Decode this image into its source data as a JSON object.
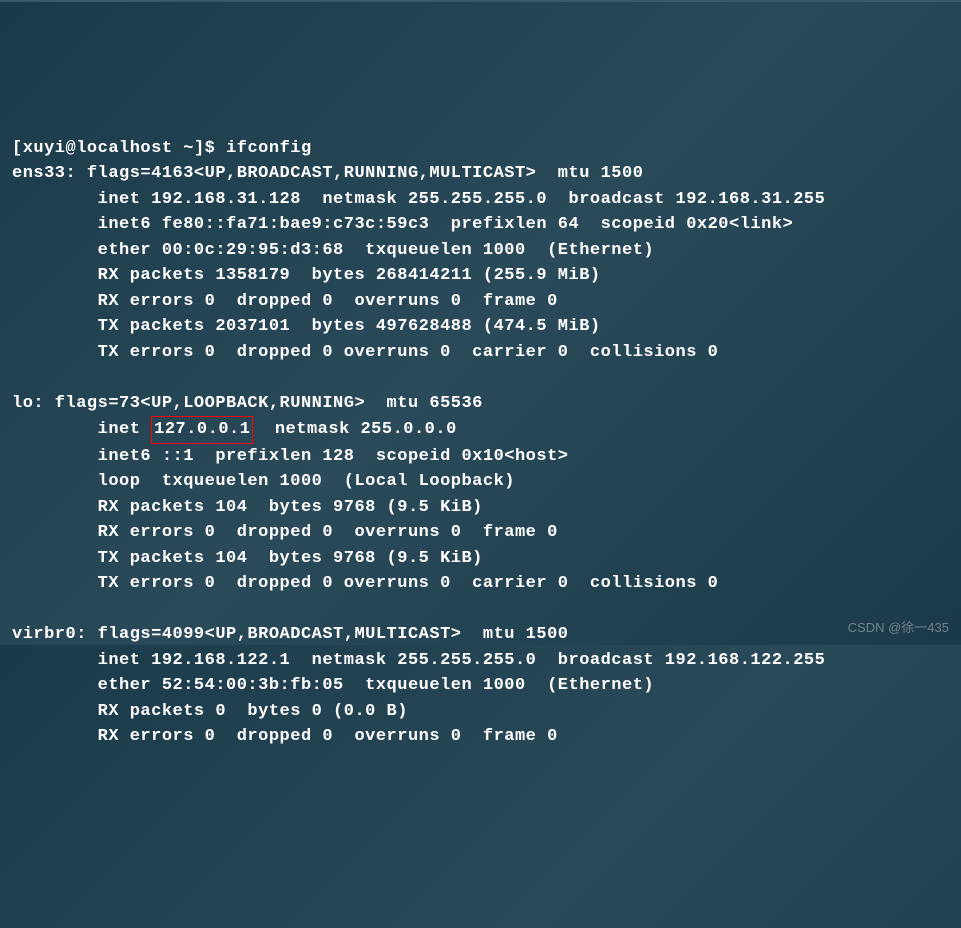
{
  "prompt": {
    "user": "xuyi",
    "host": "localhost",
    "dir": "~",
    "symbol": "$",
    "command": "ifconfig"
  },
  "interfaces": {
    "ens33": {
      "header": "ens33: flags=4163<UP,BROADCAST,RUNNING,MULTICAST>  mtu 1500",
      "inet": "        inet 192.168.31.128  netmask 255.255.255.0  broadcast 192.168.31.255",
      "inet6": "        inet6 fe80::fa71:bae9:c73c:59c3  prefixlen 64  scopeid 0x20<link>",
      "ether": "        ether 00:0c:29:95:d3:68  txqueuelen 1000  (Ethernet)",
      "rx_packets": "        RX packets 1358179  bytes 268414211 (255.9 MiB)",
      "rx_errors": "        RX errors 0  dropped 0  overruns 0  frame 0",
      "tx_packets": "        TX packets 2037101  bytes 497628488 (474.5 MiB)",
      "tx_errors": "        TX errors 0  dropped 0 overruns 0  carrier 0  collisions 0"
    },
    "lo": {
      "header": "lo: flags=73<UP,LOOPBACK,RUNNING>  mtu 65536",
      "inet_prefix": "        inet ",
      "inet_ip": "127.0.0.1",
      "inet_suffix": "  netmask 255.0.0.0",
      "inet6": "        inet6 ::1  prefixlen 128  scopeid 0x10<host>",
      "loop": "        loop  txqueuelen 1000  (Local Loopback)",
      "rx_packets": "        RX packets 104  bytes 9768 (9.5 KiB)",
      "rx_errors": "        RX errors 0  dropped 0  overruns 0  frame 0",
      "tx_packets": "        TX packets 104  bytes 9768 (9.5 KiB)",
      "tx_errors": "        TX errors 0  dropped 0 overruns 0  carrier 0  collisions 0"
    },
    "virbr0": {
      "header": "virbr0: flags=4099<UP,BROADCAST,MULTICAST>  mtu 1500",
      "inet": "        inet 192.168.122.1  netmask 255.255.255.0  broadcast 192.168.122.255",
      "ether": "        ether 52:54:00:3b:fb:05  txqueuelen 1000  (Ethernet)",
      "rx_packets": "        RX packets 0  bytes 0 (0.0 B)",
      "rx_errors": "        RX errors 0  dropped 0  overruns 0  frame 0"
    }
  },
  "watermark": "CSDN @徐一435"
}
